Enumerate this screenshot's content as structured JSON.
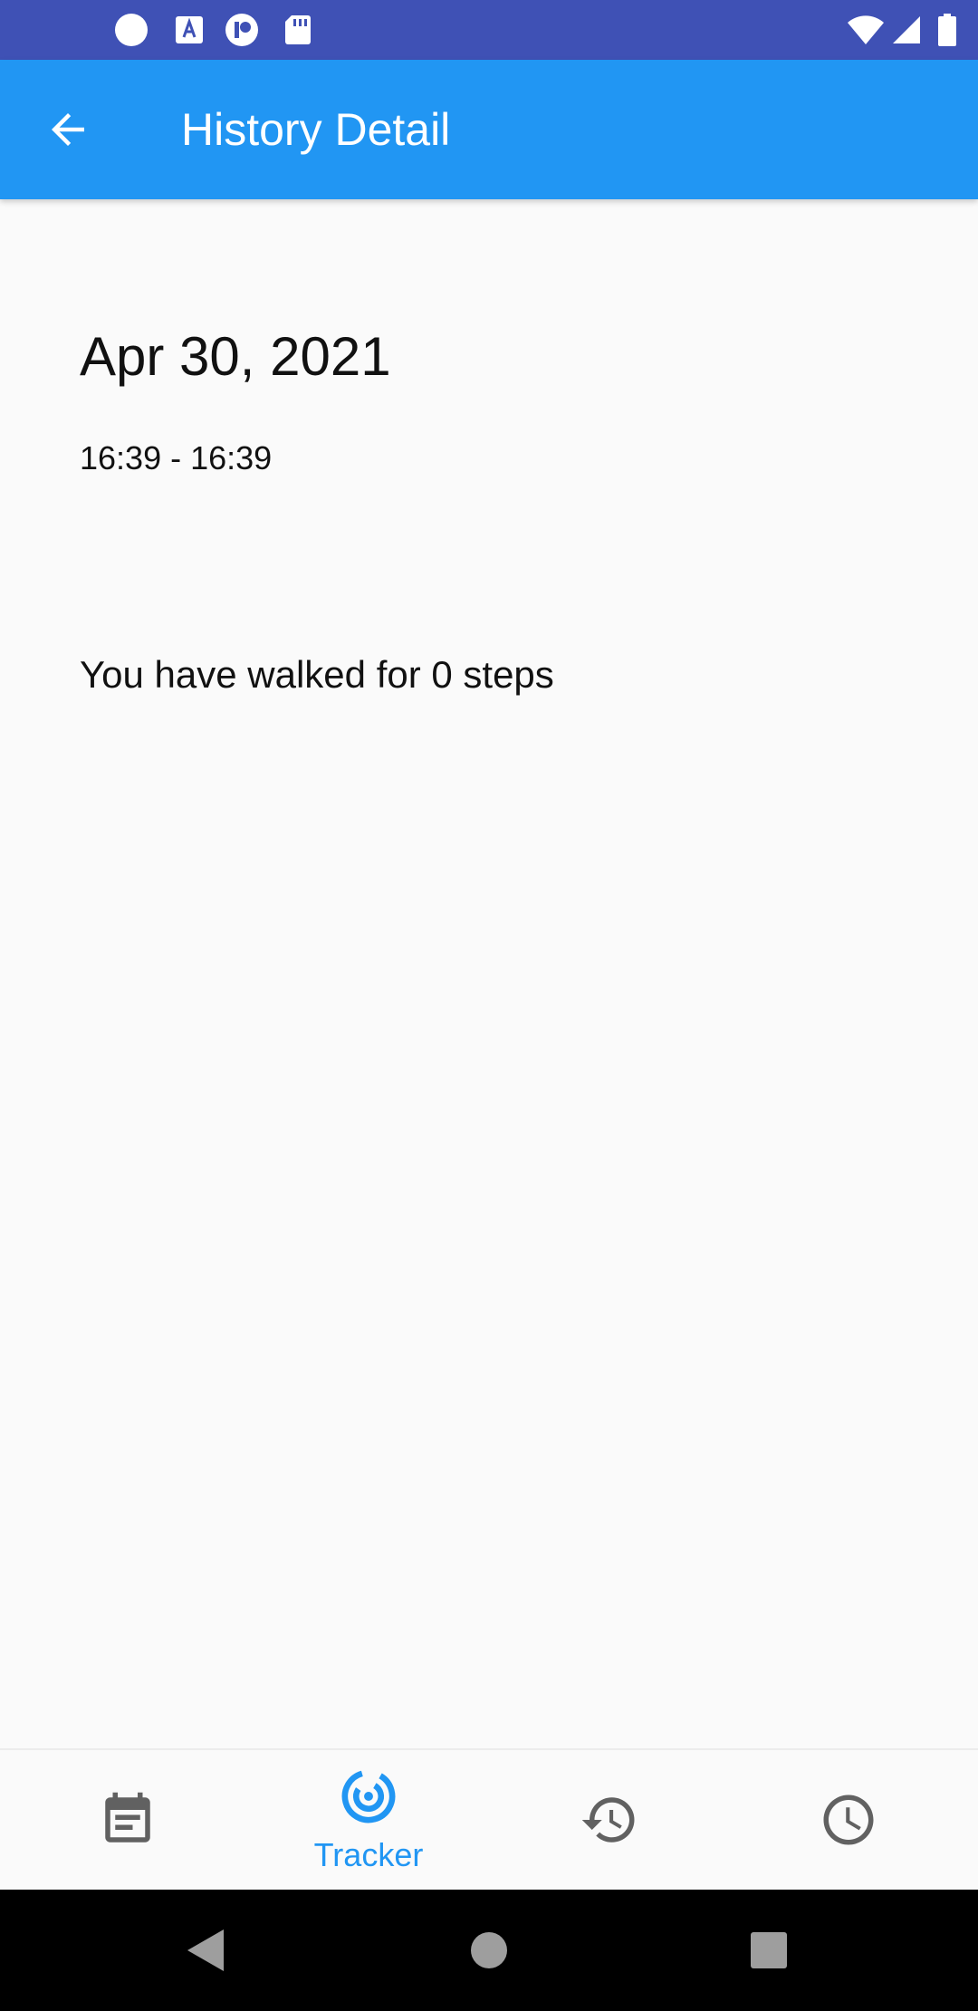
{
  "status_bar": {
    "left_icons": [
      "circle-notification-icon",
      "accessibility-a-icon",
      "app-notification-icon",
      "sd-card-icon"
    ],
    "right_icons": [
      "wifi-icon",
      "signal-icon",
      "battery-icon"
    ]
  },
  "app_bar": {
    "title": "History Detail",
    "back_icon": "arrow-back-icon",
    "color": "#2196f3"
  },
  "detail": {
    "date": "Apr 30, 2021",
    "time_range": "16:39 - 16:39",
    "steps_message": "You have walked for 0 steps"
  },
  "bottom_nav": {
    "items": [
      {
        "icon": "calendar-note-icon",
        "label": "",
        "active": false
      },
      {
        "icon": "tracker-radar-icon",
        "label": "Tracker",
        "active": true
      },
      {
        "icon": "history-icon",
        "label": "",
        "active": false
      },
      {
        "icon": "clock-icon",
        "label": "",
        "active": false
      }
    ],
    "active_color": "#2196f3",
    "inactive_color": "#616161"
  },
  "system_nav": {
    "buttons": [
      "back-triangle-icon",
      "home-circle-icon",
      "recents-square-icon"
    ]
  },
  "colors": {
    "status_bar": "#3f51b5",
    "background": "#fafafa"
  }
}
